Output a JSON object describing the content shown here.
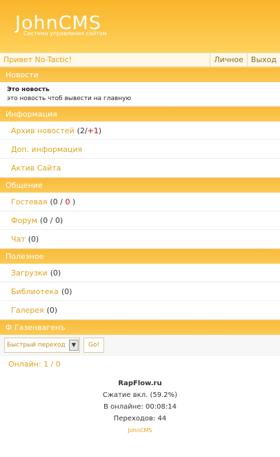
{
  "header": {
    "logo": "JohnCMS",
    "tagline": "Система управления сайтом"
  },
  "greeting": "Привет No-Tactic!",
  "topnav": [
    "Личное",
    "Выход"
  ],
  "news": {
    "heading": "Новости",
    "title": "Это новость",
    "text": "это новость чтоб вывести на главную"
  },
  "info": {
    "heading": "Информация",
    "items": [
      {
        "label": "Архив новостей",
        "count_a": "(2/",
        "count_b": "+1",
        "count_c": ")"
      },
      {
        "label": "Доп. информация"
      },
      {
        "label": "Актив Сайта"
      }
    ]
  },
  "community": {
    "heading": "Общение",
    "items": [
      {
        "label": "Гостевая",
        "count_a": "(0 /",
        "count_b": "0",
        "count_c": ")"
      },
      {
        "label": "Форум",
        "count": "(0 / 0)"
      },
      {
        "label": "Чат",
        "count": "(0)"
      }
    ]
  },
  "useful": {
    "heading": "Полезное",
    "items": [
      {
        "label": "Загрузки",
        "count": "(0)"
      },
      {
        "label": "Библиотека",
        "count": "(0)"
      },
      {
        "label": "Галерея",
        "count": "(0)"
      }
    ]
  },
  "gazen": "Ф Газенвагенъ",
  "quick_jump": {
    "selected": "Быстрый переход",
    "go": "Go!"
  },
  "online": "Онлайн: 1 / 0",
  "footer": {
    "site": "RapFlow.ru",
    "compression": "Сжатие вкл. (59.2%)",
    "online_time": "В онлайне: 00:08:14",
    "transitions": "Переходов: 44",
    "cms": "JohnCMS"
  },
  "colors": {
    "accent": "#fbc34a",
    "link": "#e0a21e",
    "red": "#cc0000"
  }
}
